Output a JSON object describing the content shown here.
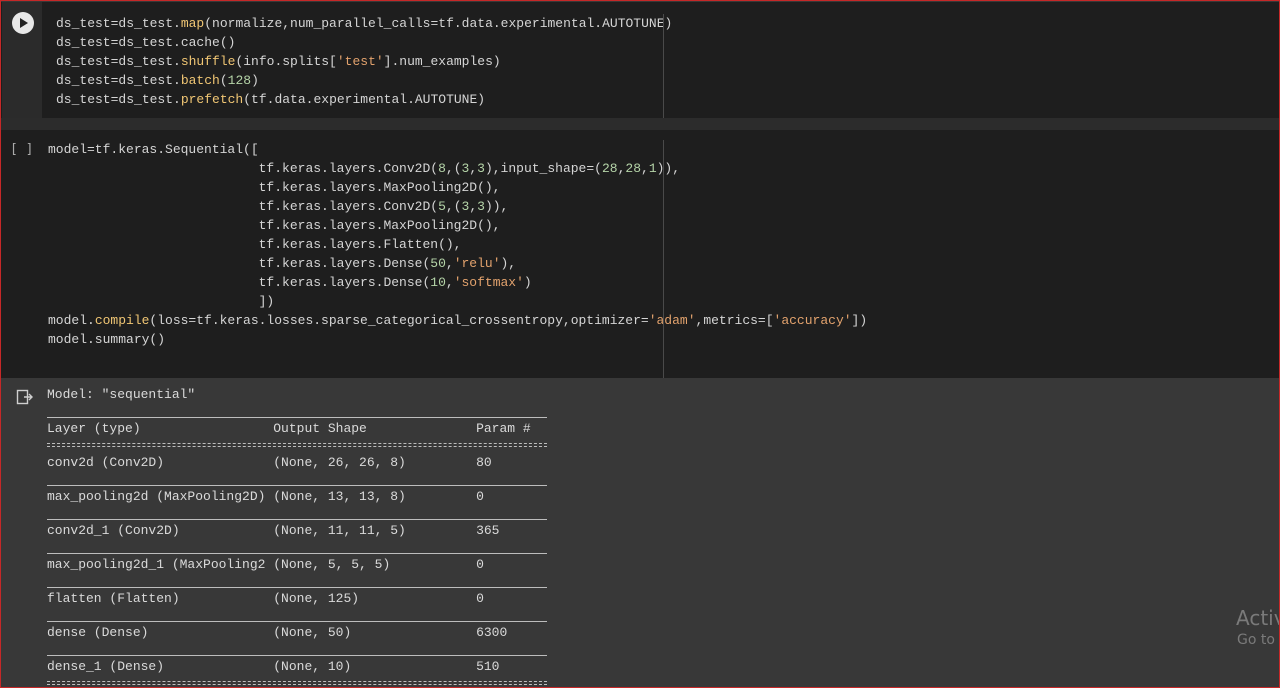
{
  "cell1": {
    "lines": [
      "ds_test=ds_test.map(normalize,num_parallel_calls=tf.data.experimental.AUTOTUNE)",
      "ds_test=ds_test.cache()",
      "ds_test=ds_test.shuffle(info.splits['test'].num_examples)",
      "ds_test=ds_test.batch(128)",
      "ds_test=ds_test.prefetch(tf.data.experimental.AUTOTUNE)"
    ]
  },
  "cell2": {
    "brackets": "[ ]",
    "lines": [
      "model=tf.keras.Sequential([",
      "                           tf.keras.layers.Conv2D(8,(3,3),input_shape=(28,28,1)),",
      "                           tf.keras.layers.MaxPooling2D(),",
      "                           tf.keras.layers.Conv2D(5,(3,3)),",
      "                           tf.keras.layers.MaxPooling2D(),",
      "                           tf.keras.layers.Flatten(),",
      "                           tf.keras.layers.Dense(50,'relu'),",
      "                           tf.keras.layers.Dense(10,'softmax')",
      "                           ])",
      "model.compile(loss=tf.keras.losses.sparse_categorical_crossentropy,optimizer='adam',metrics=['accuracy'])",
      "model.summary()"
    ]
  },
  "output": {
    "model_line": "Model: \"sequential\"",
    "header": "Layer (type)                 Output Shape              Param #",
    "rows": [
      "conv2d (Conv2D)              (None, 26, 26, 8)         80",
      "max_pooling2d (MaxPooling2D) (None, 13, 13, 8)         0",
      "conv2d_1 (Conv2D)            (None, 11, 11, 5)         365",
      "max_pooling2d_1 (MaxPooling2 (None, 5, 5, 5)           0",
      "flatten (Flatten)            (None, 125)               0",
      "dense (Dense)                (None, 50)                6300",
      "dense_1 (Dense)              (None, 10)                510"
    ]
  },
  "watermark": {
    "line1": "Activ",
    "line2": "Go to"
  },
  "colors": {
    "cell_bg": "#1e1e1e",
    "output_bg": "#383838",
    "string": "#e2a26d",
    "function": "#f0c674",
    "number": "#b5d4a8"
  }
}
